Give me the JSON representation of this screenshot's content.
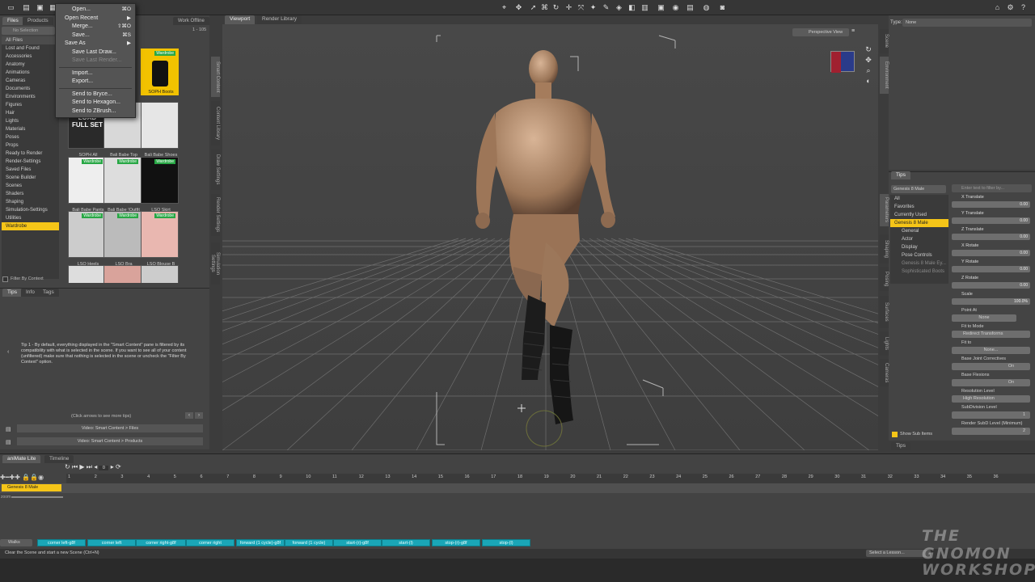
{
  "file_menu": {
    "items": [
      {
        "label": "Open...",
        "shortcut": "⌘O",
        "disabled": false
      },
      {
        "label": "Open Recent",
        "shortcut": "▶",
        "disabled": false
      },
      {
        "label": "Merge...",
        "shortcut": "⇧⌘O",
        "disabled": false
      },
      {
        "label": "Save...",
        "shortcut": "⌘S",
        "disabled": false
      },
      {
        "label": "Save As",
        "shortcut": "▶",
        "disabled": false
      },
      {
        "label": "Save Last Draw...",
        "shortcut": "",
        "disabled": false
      },
      {
        "label": "Save Last Render...",
        "shortcut": "",
        "disabled": true
      },
      {
        "label": "Import...",
        "shortcut": "",
        "disabled": false
      },
      {
        "label": "Export...",
        "shortcut": "",
        "disabled": false
      },
      {
        "label": "Send to Bryce...",
        "shortcut": "",
        "disabled": false
      },
      {
        "label": "Send to Hexagon...",
        "shortcut": "",
        "disabled": false
      },
      {
        "label": "Send to ZBrush...",
        "shortcut": "",
        "disabled": false
      }
    ]
  },
  "left_panel": {
    "tabs": [
      "Files",
      "Products"
    ],
    "work_offline": "Work Offline",
    "search_placeholder": "No Selection",
    "count": "1 - 105",
    "category_header": "All Files",
    "categories": [
      "Lost and Found",
      "Accessories",
      "Anatomy",
      "Animations",
      "Cameras",
      "Documents",
      "Environments",
      "Figures",
      "Hair",
      "Lights",
      "Materials",
      "Poses",
      "Props",
      "Ready to Render",
      "Render-Settings",
      "Saved Files",
      "Scene Builder",
      "Scenes",
      "Shaders",
      "Shaping",
      "Simulation-Settings",
      "Utilities",
      "Wardrobe"
    ],
    "filter_by_context": "Filter By Context",
    "thumbnails": [
      {
        "caption": "SOPH Boots",
        "tag": "Wardrobe",
        "selected": true
      },
      {
        "caption": "SOPH All",
        "tag": "",
        "selected": false
      },
      {
        "caption": "Bali Babe Top",
        "tag": "",
        "selected": false
      },
      {
        "caption": "Bali Babe Shoes",
        "tag": "",
        "selected": false
      },
      {
        "caption": "Bali Babe Pants",
        "tag": "Wardrobe",
        "selected": false
      },
      {
        "caption": "Bali Babe !Outfit",
        "tag": "Wardrobe",
        "selected": false
      },
      {
        "caption": "LSO Skirt",
        "tag": "Wardrobe",
        "selected": false
      },
      {
        "caption": "LSO Heels",
        "tag": "Wardrobe",
        "selected": false
      },
      {
        "caption": "LSO Bra",
        "tag": "Wardrobe",
        "selected": false
      },
      {
        "caption": "LSO Blouse B",
        "tag": "Wardrobe",
        "selected": false
      }
    ],
    "load_full_set": "LOAD FULL SET",
    "side_tabs": [
      "Smart Content",
      "Content Library",
      "Draw Settings",
      "Render Settings",
      "Simulation Settings"
    ]
  },
  "tips_panel": {
    "tabs": [
      "Tips",
      "Info",
      "Tags"
    ],
    "tip_text": "Tip 1 - By default, everything displayed in the \"Smart Content\" pane is filtered by its compatibility with what is selected in the scene. If you want to see all of your content (unfiltered) make sure that nothing is selected in the scene or uncheck the \"Filter By Context\" option.",
    "arrows_hint": "(Click arrows to see more tips)",
    "video1": "Video: Smart Content > Files",
    "video2": "Video: Smart Content > Products"
  },
  "viewport": {
    "tabs": [
      "Viewport",
      "Render Library"
    ],
    "view_select": "Perspective View"
  },
  "right_panel": {
    "type_label": "Type:",
    "type_value": "None",
    "tips_tab": "Tips",
    "side_tabs_top": [
      "Scene",
      "Environment"
    ],
    "side_tabs": [
      "Parameters",
      "Shaping",
      "Posing",
      "Surfaces",
      "Lights",
      "Cameras"
    ],
    "filter_placeholder": "Enter text to filter by...",
    "figure_select": "Genesis 8 Male",
    "tree": [
      "All",
      "Favorites",
      "Currently Used",
      "Genesis 8 Male",
      "General",
      "Actor",
      "Display",
      "Pose Controls",
      "Genesis 8 Male Ey...",
      "Sophisticated Boots"
    ],
    "show_sub_items": "Show Sub Items",
    "params": [
      {
        "label": "X Translate",
        "value": "0.00"
      },
      {
        "label": "Y Translate",
        "value": "0.00"
      },
      {
        "label": "Z Translate",
        "value": "0.00"
      },
      {
        "label": "X Rotate",
        "value": "0.00"
      },
      {
        "label": "Y Rotate",
        "value": "0.00"
      },
      {
        "label": "Z Rotate",
        "value": "0.00"
      },
      {
        "label": "Scale",
        "value": "100.0%"
      }
    ],
    "point_at_label": "Point At",
    "point_at_value": "None",
    "fit_to_mode_label": "Fit to Mode",
    "fit_to_mode_value": "Redirect Transforms",
    "fit_to_label": "Fit to",
    "fit_to_value": "None...",
    "base_joint_label": "Base Joint Correctives",
    "base_joint_value": "On",
    "base_flexions_label": "Base Flexions",
    "base_flexions_value": "On",
    "resolution_label": "Resolution Level",
    "resolution_value": "High Resolution",
    "subdiv_label": "SubDivision Level",
    "subdiv_value": "1",
    "render_subd_label": "Render SubD Level (Minimum)",
    "render_subd_value": "2"
  },
  "timeline": {
    "tabs": [
      "aniMate Lite",
      "Timeline"
    ],
    "frame_value": "0",
    "track_label": "Genesis 8 Male",
    "zoom_label": "zoom",
    "frame_numbers": [
      "1",
      "2",
      "3",
      "4",
      "5",
      "6",
      "7",
      "8",
      "9",
      "10",
      "11",
      "12",
      "13",
      "14",
      "15",
      "16",
      "17",
      "18",
      "19",
      "20",
      "21",
      "22",
      "23",
      "24",
      "25",
      "26",
      "27",
      "28",
      "29",
      "30",
      "31",
      "32",
      "33",
      "34",
      "35",
      "36"
    ],
    "walks_select": "Walks",
    "lessons": [
      "corner left-g8f",
      "corner left",
      "corner right-g8f",
      "corner right",
      "forward (1 cycle)-g8f",
      "forward (1 cycle)",
      "start-(r)-g8f",
      "start-(l)",
      "stop-(r)-g8f",
      "stop-(l)"
    ]
  },
  "status": {
    "text": "Clear the Scene and start a new Scene (Ctrl+N)",
    "lesson_select": "Select a Lesson..."
  },
  "watermark": {
    "line1": "THE GNOMON",
    "line2": "WORKSHOP"
  }
}
